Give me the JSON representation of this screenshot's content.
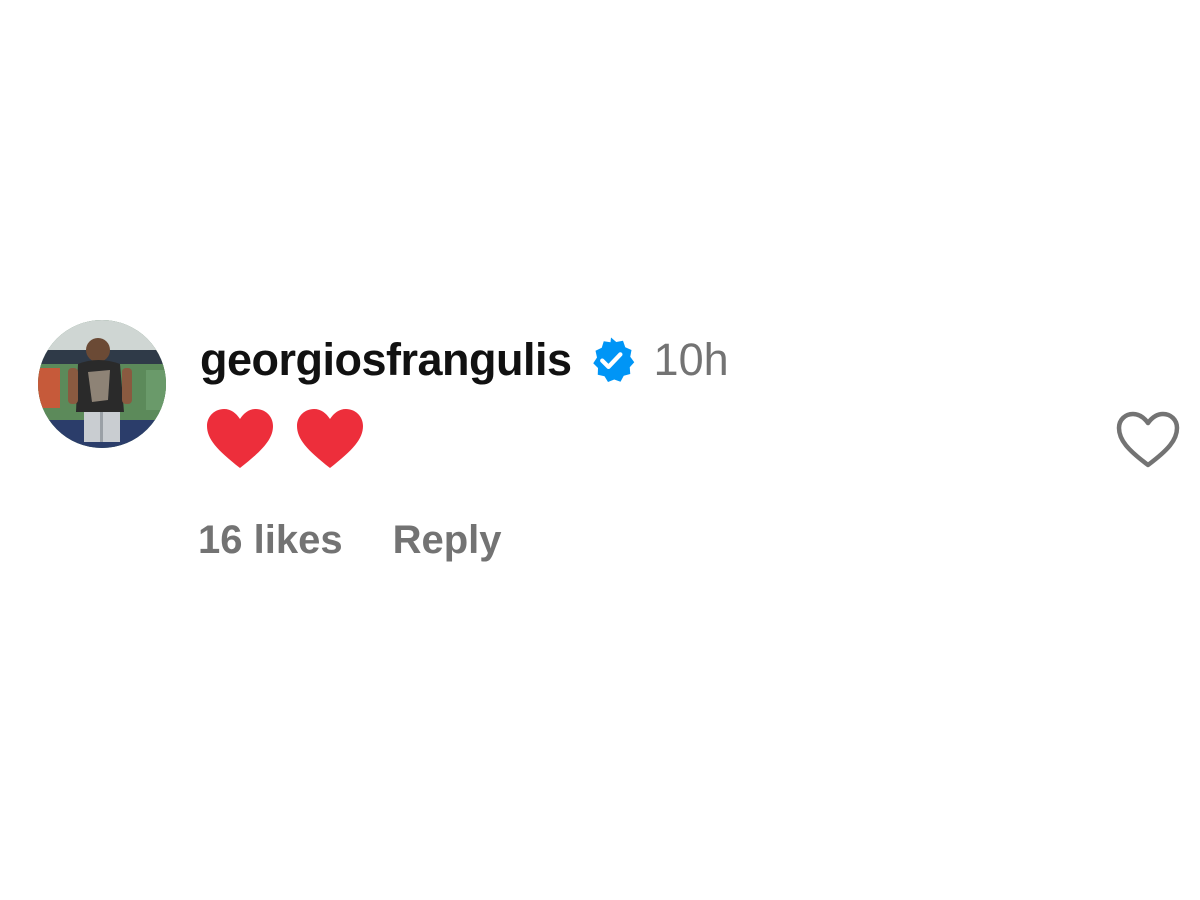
{
  "comment": {
    "username": "georgiosfrangulis",
    "verified": true,
    "time": "10h",
    "body_emojis": [
      "red-heart",
      "red-heart"
    ],
    "likes_text": "16 likes",
    "reply_label": "Reply"
  },
  "icons": {
    "verified": "verified-badge-icon",
    "like": "heart-outline-icon",
    "avatar": "profile-avatar"
  },
  "colors": {
    "verified_blue": "#0095f6",
    "heart_red": "#ed2e3b",
    "muted_text": "#737373",
    "username_text": "#111111",
    "like_outline": "#737373"
  }
}
